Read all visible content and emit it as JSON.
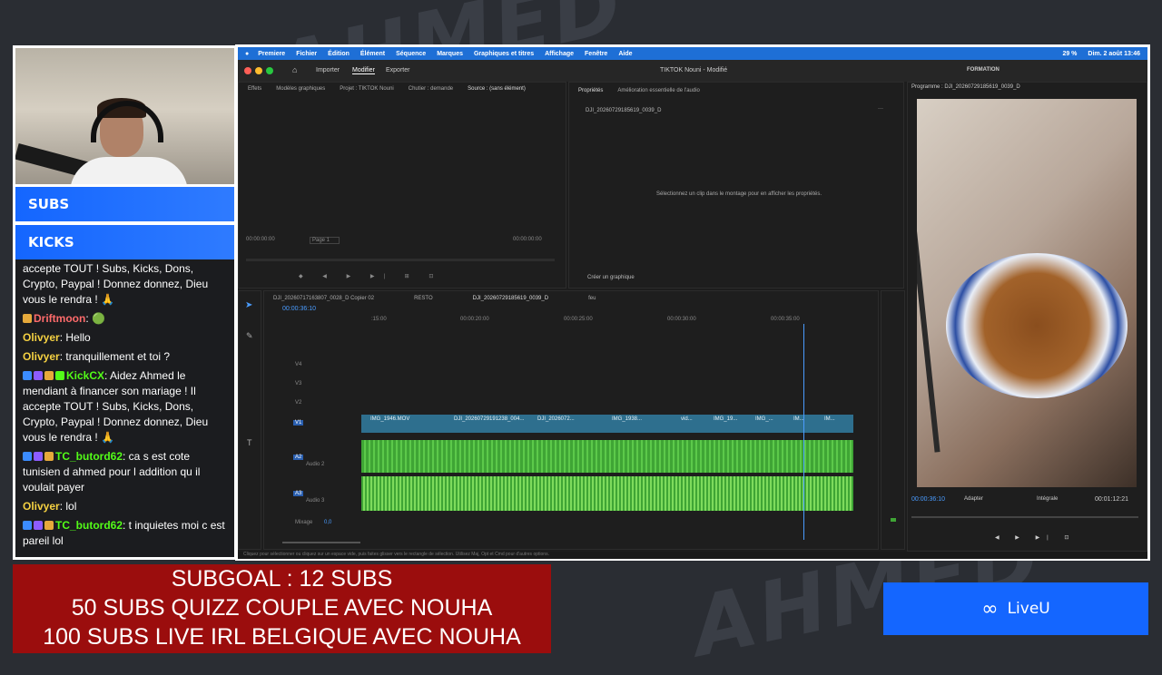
{
  "overlay": {
    "subs_label": "SUBS",
    "kicks_label": "KICKS",
    "subgoal_lines": [
      "SUBGOAL : 12 SUBS",
      "50 SUBS QUIZZ COUPLE AVEC NOUHA",
      "100 SUBS LIVE IRL BELGIQUE AVEC NOUHA"
    ],
    "liveu_label": "LiveU"
  },
  "chat": [
    {
      "user": "",
      "user_color": "#ffffff",
      "text": "accepte TOUT ! Subs, Kicks, Dons, Crypto, Paypal ! Donnez donnez, Dieu vous le rendra ! 🙏"
    },
    {
      "user": "Driftmoon",
      "user_color": "#ff6b6b",
      "text": ": 🟢"
    },
    {
      "user": "Olivyer",
      "user_color": "#f5d142",
      "text": ": Hello"
    },
    {
      "user": "Olivyer",
      "user_color": "#f5d142",
      "text": ": tranquillement et toi ?"
    },
    {
      "user": "KickCX",
      "user_color": "#53fc18",
      "text": ": Aidez Ahmed le mendiant à financer son mariage ! Il accepte TOUT ! Subs, Kicks, Dons, Crypto, Paypal ! Donnez donnez, Dieu vous le rendra ! 🙏"
    },
    {
      "user": "TC_butord62",
      "user_color": "#53fc18",
      "text": ": ca s est cote tunisien d ahmed pour l addition qu il voulait payer"
    },
    {
      "user": "Olivyer",
      "user_color": "#f5d142",
      "text": ": lol"
    },
    {
      "user": "TC_butord62",
      "user_color": "#53fc18",
      "text": ": t inquietes moi c est pareil lol"
    }
  ],
  "menubar": {
    "items": [
      "Premiere",
      "Fichier",
      "Édition",
      "Élément",
      "Séquence",
      "Marques",
      "Graphiques et titres",
      "Affichage",
      "Fenêtre",
      "Aide"
    ],
    "battery": "29 %",
    "datetime": "Dim. 2 août  13:46"
  },
  "app": {
    "tabs": [
      "Importer",
      "Modifier",
      "Exporter"
    ],
    "title": "TIKTOK Nouni - Modifié",
    "workspace": "FORMATION"
  },
  "source_panel": {
    "tabs": [
      "Effets",
      "Modèles graphiques",
      "Projet : TIKTOK Nouni",
      "Chutier : demande",
      "Source : (sans élément)"
    ],
    "timecode_left": "00:00:00:00",
    "timecode_right": "00:00:00:00",
    "page_select": "Page 1"
  },
  "properties_panel": {
    "tabs": [
      "Propriétés",
      "Amélioration essentielle de l'audio"
    ],
    "clip_name": "DJI_20260729185619_0039_D",
    "message": "Sélectionnez un clip dans le montage pour en afficher les propriétés.",
    "create_graphic": "Créer un graphique"
  },
  "program_panel": {
    "title": "Programme : DJI_20260729185619_0039_D",
    "timecode": "00:00:36:10",
    "fit": "Adapter",
    "quality": "Intégrale",
    "duration": "00:01:12:21"
  },
  "timeline": {
    "tabs": [
      "DJI_20260717163807_0028_D Copier 02",
      "RESTO",
      "DJI_20260729185619_0039_D",
      "feu"
    ],
    "timecode": "00:00:36:10",
    "ruler": [
      ":15:00",
      "00:00:20:00",
      "00:00:25:00",
      "00:00:30:00",
      "00:00:35:00"
    ],
    "tracks": [
      "V4",
      "V3",
      "V2",
      "V1",
      "A2",
      "A3"
    ],
    "audio_names": [
      "Audio 2",
      "Audio 3"
    ],
    "mix_label": "Mixage",
    "mix_value": "0,0",
    "clips": [
      "IMG_1946.MOV",
      "DJI_20260729191238_004...",
      "DJI_2026072...",
      "IMG_1938...",
      "vid...",
      "IMG_19...",
      "IMG_...",
      "IM...",
      "IM..."
    ]
  },
  "status_hint": "Cliquez pour sélectionner ou cliquez sur un espace vide, puis faites glisser vers le rectangle de sélection. Utilisez Maj, Opt et Cmd pour d'autres options.",
  "colors": {
    "accent": "#1466ff",
    "video_clip": "#2e6f8e",
    "audio_clip": "#3fa535",
    "subgoal_bg": "#9b0d0d"
  }
}
